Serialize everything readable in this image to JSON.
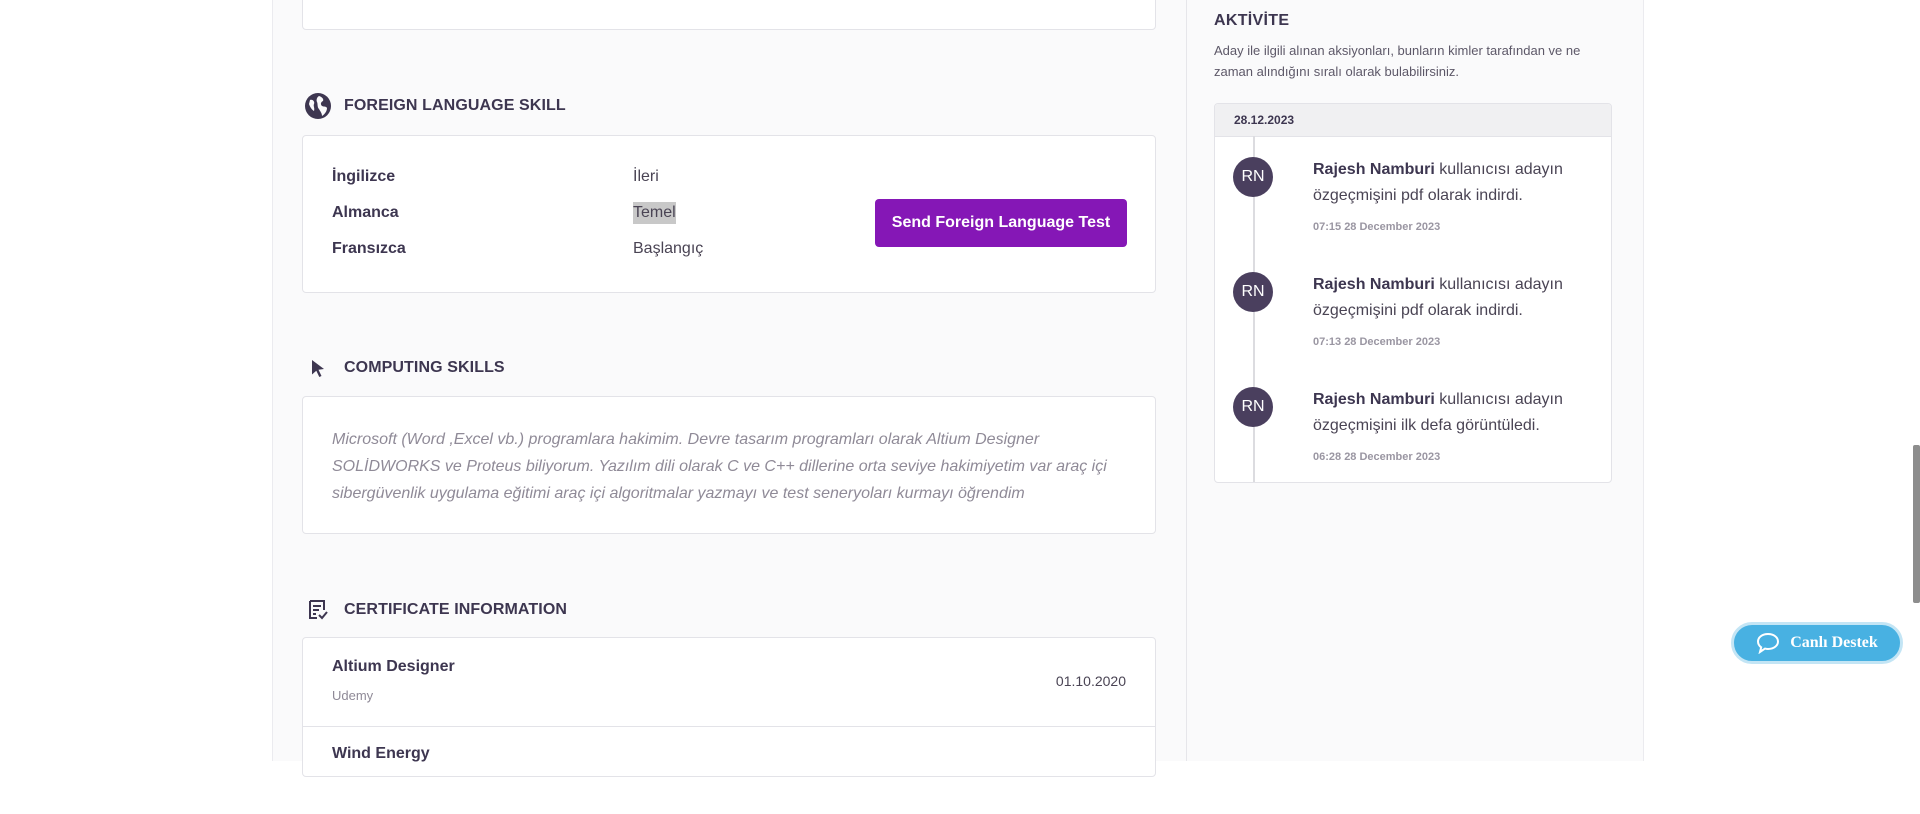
{
  "language_section": {
    "title": "FOREIGN LANGUAGE SKILL",
    "languages": [
      {
        "name": "İngilizce",
        "level": "İleri"
      },
      {
        "name": "Almanca",
        "level": "Temel"
      },
      {
        "name": "Fransızca",
        "level": "Başlangıç"
      }
    ],
    "send_button_label": "Send Foreign Language Test"
  },
  "computing_section": {
    "title": "COMPUTING SKILLS",
    "text": "Microsoft (Word ,Excel vb.) programlara hakimim. Devre tasarım programları olarak Altium Designer SOLİDWORKS ve Proteus biliyorum. Yazılım dili olarak C ve C++ dillerine orta seviye hakimiyetim var araç içi sibergüvenlik uygulama eğitimi araç içi algoritmalar yazmayı ve test seneryoları kurmayı öğrendim"
  },
  "certificate_section": {
    "title": "CERTIFICATE INFORMATION",
    "items": [
      {
        "title": "Altium Designer",
        "issuer": "Udemy",
        "date": "01.10.2020"
      },
      {
        "title": "Wind Energy",
        "issuer": "",
        "date": ""
      }
    ]
  },
  "activity": {
    "title": "AKTİVİTE",
    "description": "Aday ile ilgili alınan aksiyonları, bunların kimler tarafından ve ne zaman alındığını sıralı olarak bulabilirsiniz.",
    "date_group": "28.12.2023",
    "entries": [
      {
        "initials": "RN",
        "user": "Rajesh Namburi",
        "action": " kullanıcısı adayın özgeçmişini pdf olarak indirdi.",
        "time": "07:15 28 December 2023"
      },
      {
        "initials": "RN",
        "user": "Rajesh Namburi",
        "action": " kullanıcısı adayın özgeçmişini pdf olarak indirdi.",
        "time": "07:13 28 December 2023"
      },
      {
        "initials": "RN",
        "user": "Rajesh Namburi",
        "action": " kullanıcısı adayın özgeçmişini ilk defa görüntüledi.",
        "time": "06:28 28 December 2023"
      }
    ]
  },
  "live_support": {
    "label": "Canlı Destek"
  },
  "colors": {
    "accent": "#8517b6",
    "avatar": "#4a3f5e",
    "live_support": "#48b1e2"
  },
  "icons": {
    "language": "globe-icon",
    "computing": "cursor-icon",
    "certificate": "certificate-icon",
    "chat": "chat-bubble-icon"
  }
}
